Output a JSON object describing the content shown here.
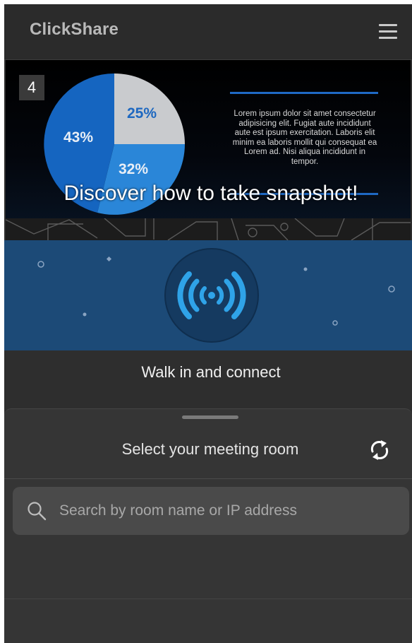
{
  "header": {
    "logo_text": "ClickShare",
    "menu_icon": "hamburger-menu-icon"
  },
  "snapshot_slide": {
    "slide_number": "4",
    "pie_chart": {
      "slices": [
        {
          "label": "25%",
          "value": 25,
          "color": "#c9cbce"
        },
        {
          "label": "32%",
          "value": 32,
          "color": "#2a86d8"
        },
        {
          "label": "43%",
          "value": 43,
          "color": "#1565c0"
        }
      ]
    },
    "body_text": "Lorem ipsum dolor sit amet consectetur adipisicing elit. Fugiat aute incididunt aute est ipsum exercitation. Laboris elit minim ea laboris mollit qui consequat ea Lorem ad. Nisi aliqua incididunt in tempor.",
    "title": "Discover how to take snapshot!"
  },
  "walk_in": {
    "icon": "wireless-signal-icon",
    "caption": "Walk in and connect"
  },
  "room_selector": {
    "title": "Select your meeting room",
    "refresh_icon": "refresh-icon",
    "search": {
      "placeholder": "Search by room name or IP address",
      "value": "",
      "icon": "search-icon"
    }
  },
  "colors": {
    "background": "#2e2e2e",
    "banner": "#1c4a77",
    "accent_blue": "#1f69c4",
    "text": "#f0f0f0"
  }
}
